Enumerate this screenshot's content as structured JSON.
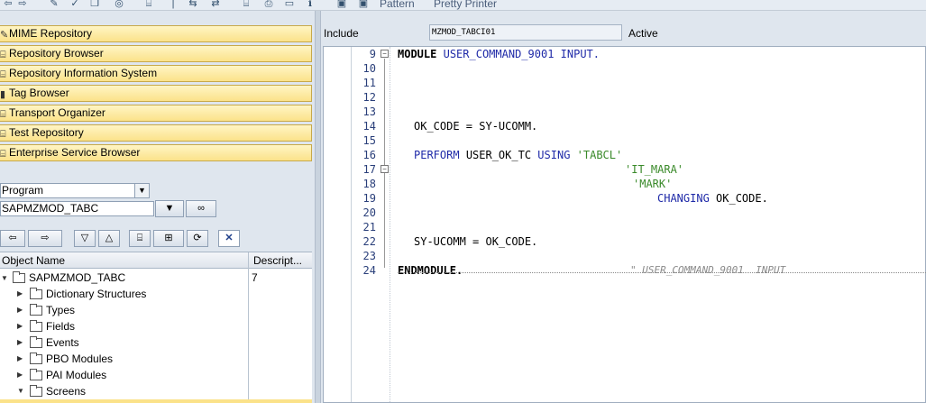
{
  "toolbar": {
    "pattern_label": "Pattern",
    "pretty_printer_label": "Pretty Printer"
  },
  "navigation": {
    "items": [
      {
        "label": "MIME Repository",
        "icon": "pencil-icon"
      },
      {
        "label": "Repository Browser",
        "icon": "hierarchy-icon"
      },
      {
        "label": "Repository Information System",
        "icon": "hierarchy-icon"
      },
      {
        "label": "Tag Browser",
        "icon": "tag-icon"
      },
      {
        "label": "Transport Organizer",
        "icon": "truck-icon"
      },
      {
        "label": "Test Repository",
        "icon": "test-icon"
      },
      {
        "label": "Enterprise Service Browser",
        "icon": "hierarchy-icon"
      }
    ]
  },
  "object_selector": {
    "type_value": "Program",
    "name_value": "SAPMZMOD_TABC"
  },
  "tree": {
    "columns": [
      "Object Name",
      "Descript..."
    ],
    "root": {
      "label": "SAPMZMOD_TABC",
      "description": "7"
    },
    "children": [
      {
        "label": "Dictionary Structures"
      },
      {
        "label": "Types"
      },
      {
        "label": "Fields"
      },
      {
        "label": "Events"
      },
      {
        "label": "PBO Modules"
      },
      {
        "label": "PAI Modules"
      },
      {
        "label": "Screens"
      }
    ]
  },
  "editor": {
    "include_label": "Include",
    "include_name": "MZMOD_TABCI01",
    "status": "Active",
    "line_numbers": [
      "9",
      "10",
      "11",
      "12",
      "13",
      "14",
      "15",
      "16",
      "17",
      "18",
      "19",
      "20",
      "21",
      "22",
      "23",
      "24"
    ],
    "lines": {
      "l9_kw": "MODULE",
      "l9_name": "USER_COMMAND_9001",
      "l9_input": "INPUT.",
      "l14": "OK_CODE = SY-UCOMM.",
      "l16_perform": "PERFORM",
      "l16_name": "USER_OK_TC",
      "l16_using": "USING",
      "l16_str": "'TABCL'",
      "l17_str": "'IT_MARA'",
      "l18_str": "'MARK'",
      "l19_changing": "CHANGING",
      "l19_rest": "OK_CODE.",
      "l22": "SY-UCOMM = OK_CODE.",
      "l24_kw": "ENDMODULE.",
      "l24_comment": "\" USER_COMMAND_9001  INPUT"
    }
  },
  "colors": {
    "nav_button": "#fbe28a",
    "keyword": "#1f2aa8",
    "string": "#3a8a2a",
    "comment": "#8a8a8a"
  }
}
